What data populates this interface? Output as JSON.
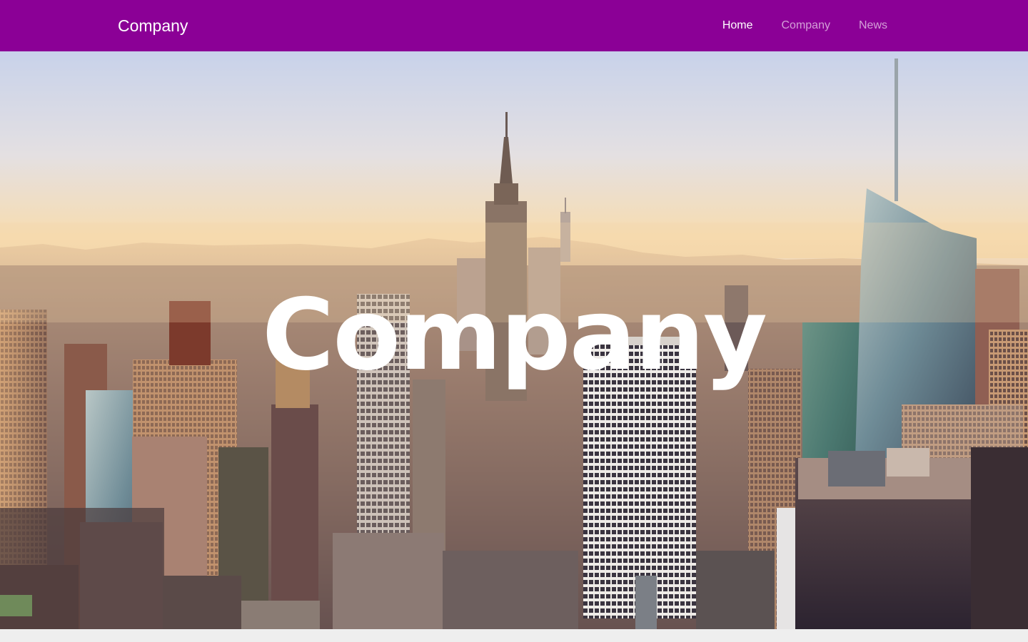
{
  "colors": {
    "navbar_bg": "#8b0096",
    "page_bg": "#eeeeee",
    "sky_top": "#c9d2e8",
    "sky_horizon": "#f6d9ad",
    "city_shadow": "#3b2f3b",
    "glass_tower": "#7e9aa8"
  },
  "navbar": {
    "brand": "Company",
    "links": [
      {
        "label": "Home",
        "active": true
      },
      {
        "label": "Company",
        "active": false
      },
      {
        "label": "News",
        "active": false
      }
    ]
  },
  "hero": {
    "title": "Company",
    "background": "city-skyline-photo"
  }
}
